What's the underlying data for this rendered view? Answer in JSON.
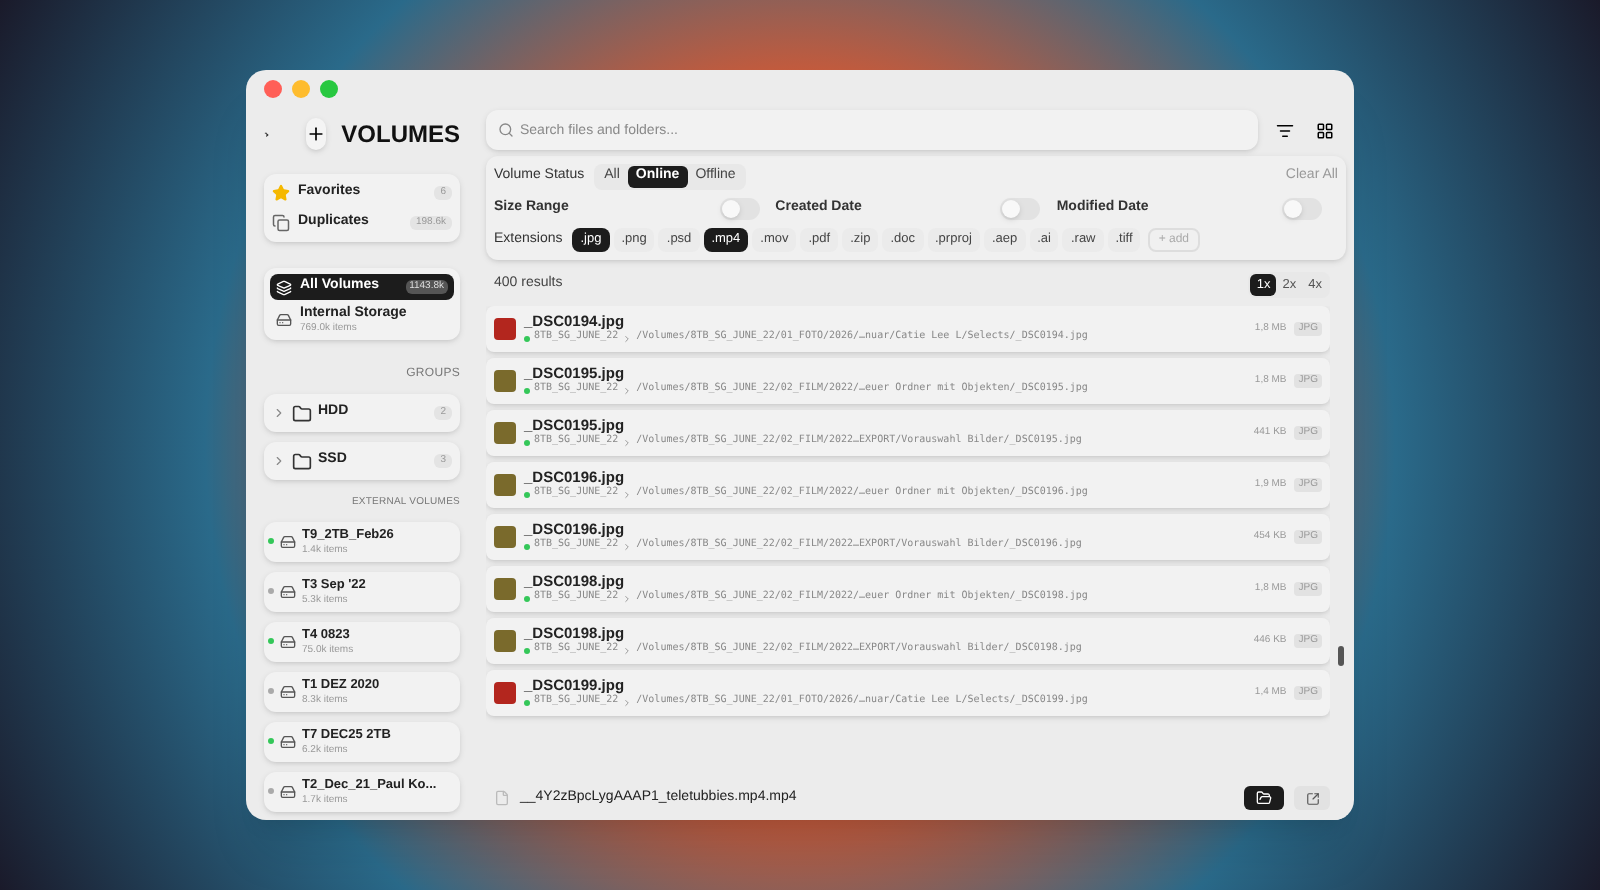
{
  "app_title": "VOLUMES",
  "library": [
    {
      "label": "Favorites",
      "count": "6",
      "kind": "star"
    },
    {
      "label": "Duplicates",
      "count": "198.6k",
      "kind": "copy"
    }
  ],
  "all_volumes": {
    "label": "All Volumes",
    "count": "1143.8k",
    "selected": true
  },
  "internal": {
    "label": "Internal Storage",
    "sub": "769.0k items",
    "selected": false
  },
  "groups_heading": "GROUPS",
  "groups": [
    {
      "label": "HDD",
      "count": "2",
      "expanded": false
    },
    {
      "label": "SSD",
      "count": "3",
      "expanded": false
    }
  ],
  "external_heading": "EXTERNAL VOLUMES",
  "external": [
    {
      "label": "T9_2TB_Feb26",
      "sub": "1.4k items",
      "online": true
    },
    {
      "label": "T3 Sep '22",
      "sub": "5.3k items",
      "online": false
    },
    {
      "label": "T4 0823",
      "sub": "75.0k items",
      "online": true
    },
    {
      "label": "T1 DEZ 2020",
      "sub": "8.3k items",
      "online": false
    },
    {
      "label": "T7 DEC25 2TB",
      "sub": "6.2k items",
      "online": true
    },
    {
      "label": "T2_Dec_21_Paul Ko...",
      "sub": "1.7k items",
      "online": false
    }
  ],
  "search": {
    "placeholder": "Search files and folders..."
  },
  "filters": {
    "status_label": "Volume Status",
    "status": [
      {
        "label": "All",
        "selected": false
      },
      {
        "label": "Online",
        "selected": true
      },
      {
        "label": "Offline",
        "selected": false
      }
    ],
    "clear": "Clear All",
    "toggles": [
      {
        "label": "Size Range",
        "on": false
      },
      {
        "label": "Created Date",
        "on": false
      },
      {
        "label": "Modified Date",
        "on": false
      }
    ],
    "ext_label": "Extensions",
    "extensions": [
      {
        "label": ".jpg",
        "selected": true
      },
      {
        "label": ".png",
        "selected": false
      },
      {
        "label": ".psd",
        "selected": false
      },
      {
        "label": ".mp4",
        "selected": true
      },
      {
        "label": ".mov",
        "selected": false
      },
      {
        "label": ".pdf",
        "selected": false
      },
      {
        "label": ".zip",
        "selected": false
      },
      {
        "label": ".doc",
        "selected": false
      },
      {
        "label": ".prproj",
        "selected": false
      },
      {
        "label": ".aep",
        "selected": false
      },
      {
        "label": ".ai",
        "selected": false
      },
      {
        "label": ".raw",
        "selected": false
      },
      {
        "label": ".tiff",
        "selected": false
      }
    ],
    "add": "+ add"
  },
  "results": "400 results",
  "zoom": [
    {
      "label": "1x",
      "selected": true
    },
    {
      "label": "2x",
      "selected": false
    },
    {
      "label": "4x",
      "selected": false
    }
  ],
  "files": [
    {
      "name": "_DSC0194.jpg",
      "volume": "8TB_SG_JUNE_22",
      "path": "/Volumes/8TB_SG_JUNE_22/01_FOTO/2026/…nuar/Catie Lee L/Selects/_DSC0194.jpg",
      "size": "1,8 MB",
      "type": "JPG",
      "color": "#b3261e"
    },
    {
      "name": "_DSC0195.jpg",
      "volume": "8TB_SG_JUNE_22",
      "path": "/Volumes/8TB_SG_JUNE_22/02_FILM/2022/…euer Ordner mit Objekten/_DSC0195.jpg",
      "size": "1,8 MB",
      "type": "JPG",
      "color": "#7a6a2c"
    },
    {
      "name": "_DSC0195.jpg",
      "volume": "8TB_SG_JUNE_22",
      "path": "/Volumes/8TB_SG_JUNE_22/02_FILM/2022…EXPORT/Vorauswahl Bilder/_DSC0195.jpg",
      "size": "441 KB",
      "type": "JPG",
      "color": "#7a6a2c"
    },
    {
      "name": "_DSC0196.jpg",
      "volume": "8TB_SG_JUNE_22",
      "path": "/Volumes/8TB_SG_JUNE_22/02_FILM/2022/…euer Ordner mit Objekten/_DSC0196.jpg",
      "size": "1,9 MB",
      "type": "JPG",
      "color": "#7a6a2c"
    },
    {
      "name": "_DSC0196.jpg",
      "volume": "8TB_SG_JUNE_22",
      "path": "/Volumes/8TB_SG_JUNE_22/02_FILM/2022…EXPORT/Vorauswahl Bilder/_DSC0196.jpg",
      "size": "454 KB",
      "type": "JPG",
      "color": "#7a6a2c"
    },
    {
      "name": "_DSC0198.jpg",
      "volume": "8TB_SG_JUNE_22",
      "path": "/Volumes/8TB_SG_JUNE_22/02_FILM/2022/…euer Ordner mit Objekten/_DSC0198.jpg",
      "size": "1,8 MB",
      "type": "JPG",
      "color": "#7a6a2c"
    },
    {
      "name": "_DSC0198.jpg",
      "volume": "8TB_SG_JUNE_22",
      "path": "/Volumes/8TB_SG_JUNE_22/02_FILM/2022…EXPORT/Vorauswahl Bilder/_DSC0198.jpg",
      "size": "446 KB",
      "type": "JPG",
      "color": "#7a6a2c"
    },
    {
      "name": "_DSC0199.jpg",
      "volume": "8TB_SG_JUNE_22",
      "path": "/Volumes/8TB_SG_JUNE_22/01_FOTO/2026/…nuar/Catie Lee L/Selects/_DSC0199.jpg",
      "size": "1,4 MB",
      "type": "JPG",
      "color": "#b3261e"
    }
  ],
  "footer": {
    "filename": "__4Y2zBpcLygAAAP1_teletubbies.mp4.mp4"
  }
}
